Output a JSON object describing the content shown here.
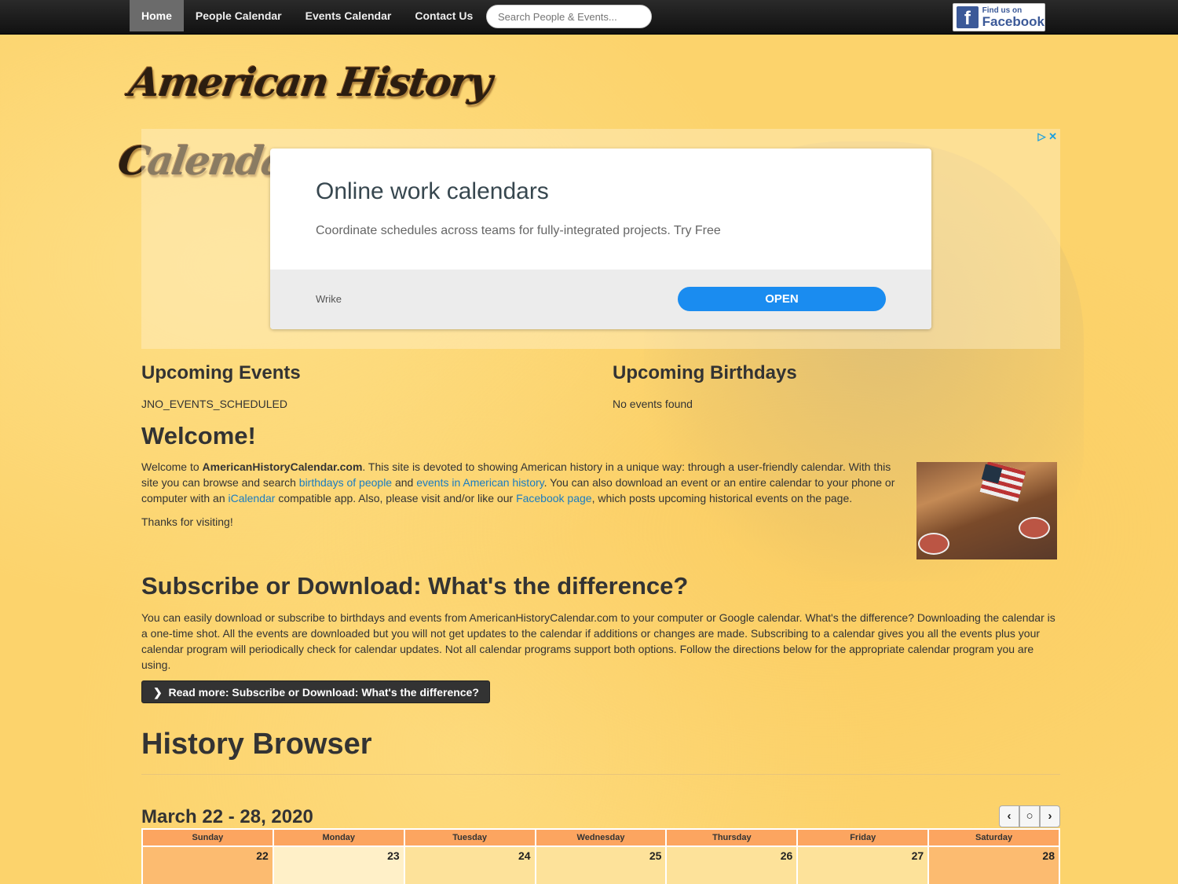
{
  "nav": {
    "items": [
      "Home",
      "People Calendar",
      "Events Calendar",
      "Contact Us"
    ],
    "search_placeholder": "Search People & Events...",
    "facebook_small": "Find us on",
    "facebook_big": "Facebook"
  },
  "logo_text": "American History Calendar",
  "ad": {
    "title": "Online work calendars",
    "description": "Coordinate schedules across teams for fully-integrated projects. Try Free",
    "brand": "Wrike",
    "cta": "OPEN"
  },
  "upcoming_events": {
    "heading": "Upcoming Events",
    "text": "JNO_EVENTS_SCHEDULED"
  },
  "upcoming_birthdays": {
    "heading": "Upcoming Birthdays",
    "text": "No events found"
  },
  "welcome": {
    "heading": "Welcome!",
    "p1_a": "Welcome to ",
    "p1_site": "AmericanHistoryCalendar.com",
    "p1_b": ". This site is devoted to showing American history in a unique way: through a user-friendly calendar.  With this site you can browse and search ",
    "link_birthdays": "birthdays of people",
    "p1_c": " and ",
    "link_events": "events in American history",
    "p1_d": ". You can also download an event or an entire calendar to your phone or computer with an ",
    "link_icalendar": "iCalendar",
    "p1_e": " compatible app.  Also, please visit and/or like our ",
    "link_facebook": "Facebook page",
    "p1_f": ", which posts upcoming historical events on the page.",
    "p2": "Thanks for visiting!"
  },
  "subscribe": {
    "heading": "Subscribe or Download: What's the difference?",
    "text": "You can easily download or subscribe to birthdays and events from AmericanHistoryCalendar.com to your computer or Google calendar. What's the difference? Downloading the calendar is a one-time shot. All the events are downloaded but you will not get updates to the calendar if additions or changes are made. Subscribing to a calendar gives you all the events plus your calendar program will periodically check for calendar updates. Not all calendar programs support both options. Follow the directions below for the appropriate calendar program you are using.",
    "button": "Read more: Subscribe or Download: What's the difference?"
  },
  "history_browser": {
    "heading": "History Browser"
  },
  "calendar": {
    "title": "March 22 - 28, 2020",
    "nav_prev": "‹",
    "nav_today": "○",
    "nav_next": "›",
    "days": [
      "Sunday",
      "Monday",
      "Tuesday",
      "Wednesday",
      "Thursday",
      "Friday",
      "Saturday"
    ],
    "dates": [
      "22",
      "23",
      "24",
      "25",
      "26",
      "27",
      "28"
    ]
  },
  "colors": {
    "page_bg": "#fcd36c",
    "navbar": "#1a1a1a",
    "link": "#1a7cc1",
    "ad_button": "#1a8cf0",
    "calendar_header": "#fca560"
  }
}
